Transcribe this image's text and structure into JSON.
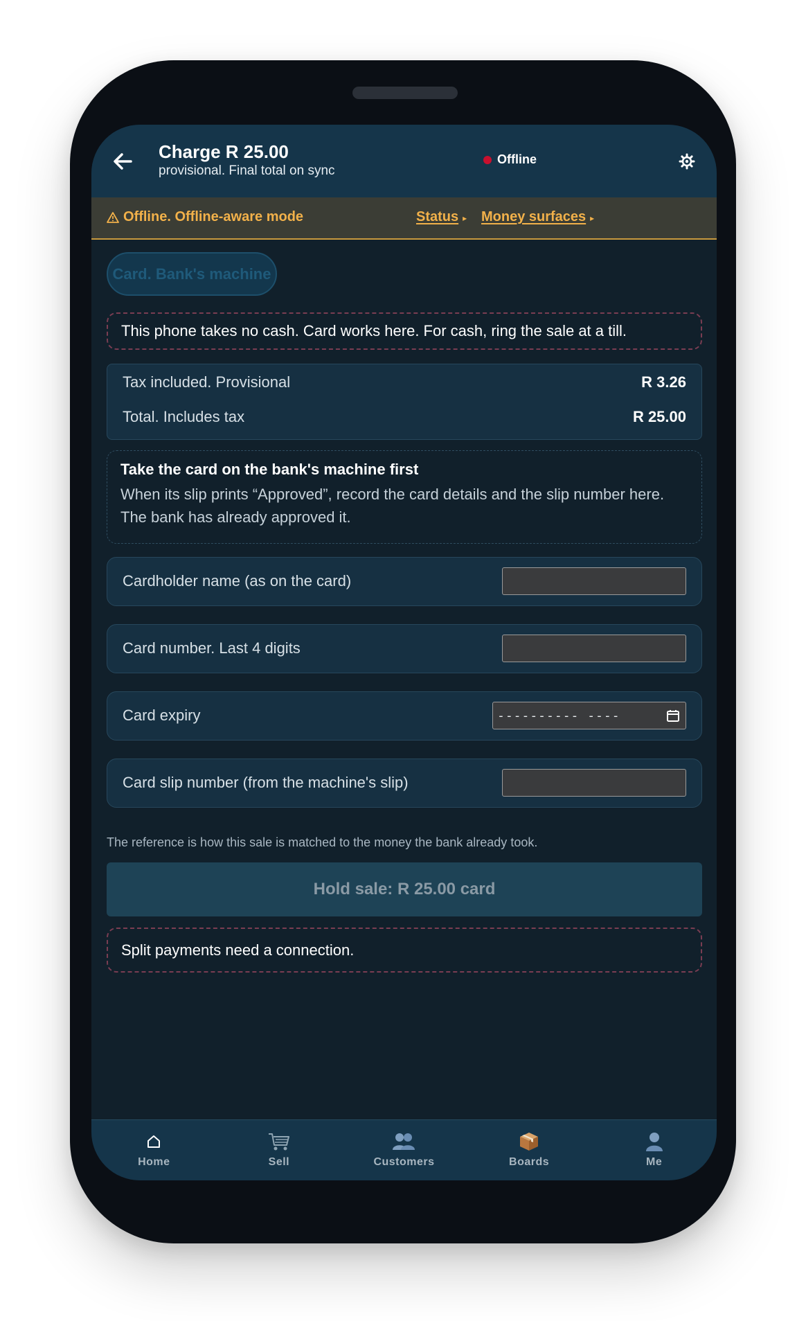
{
  "header": {
    "title": "Charge R 25.00",
    "subtitle": "provisional. Final total on sync",
    "status": "Offline",
    "status_color": "#c8102e"
  },
  "banner": {
    "text": "Offline. Offline-aware mode",
    "link_status": "Status",
    "link_money": "Money surfaces",
    "color": "#f2b14a"
  },
  "method_chip": "Card. Bank's machine",
  "no_cash_notice": "This phone takes no cash. Card works here. For cash, ring the sale at a till.",
  "totals": {
    "tax_label": "Tax included. Provisional",
    "tax_value": "R 3.26",
    "total_label": "Total. Includes tax",
    "total_value": "R 25.00"
  },
  "instructions": {
    "title": "Take the card on the bank's machine first",
    "body": "When its slip prints “Approved”, record the card details and the slip number here. The bank has already approved it."
  },
  "fields": {
    "cardholder": {
      "label": "Cardholder name (as on the card)",
      "value": ""
    },
    "card_number": {
      "label": "Card number. Last 4 digits",
      "value": ""
    },
    "expiry": {
      "label": "Card expiry",
      "value": "---------- ----"
    },
    "slip": {
      "label": "Card slip number (from the machine's slip)",
      "value": ""
    }
  },
  "reference_note": "The reference is how this sale is matched to the money the bank already took.",
  "hold_button": "Hold sale: R 25.00 card",
  "split_notice": "Split payments need a connection.",
  "nav": [
    {
      "label": "Home",
      "icon": "home-icon"
    },
    {
      "label": "Sell",
      "icon": "cart-icon"
    },
    {
      "label": "Customers",
      "icon": "people-icon"
    },
    {
      "label": "Boards",
      "icon": "box-icon"
    },
    {
      "label": "Me",
      "icon": "person-icon"
    }
  ]
}
